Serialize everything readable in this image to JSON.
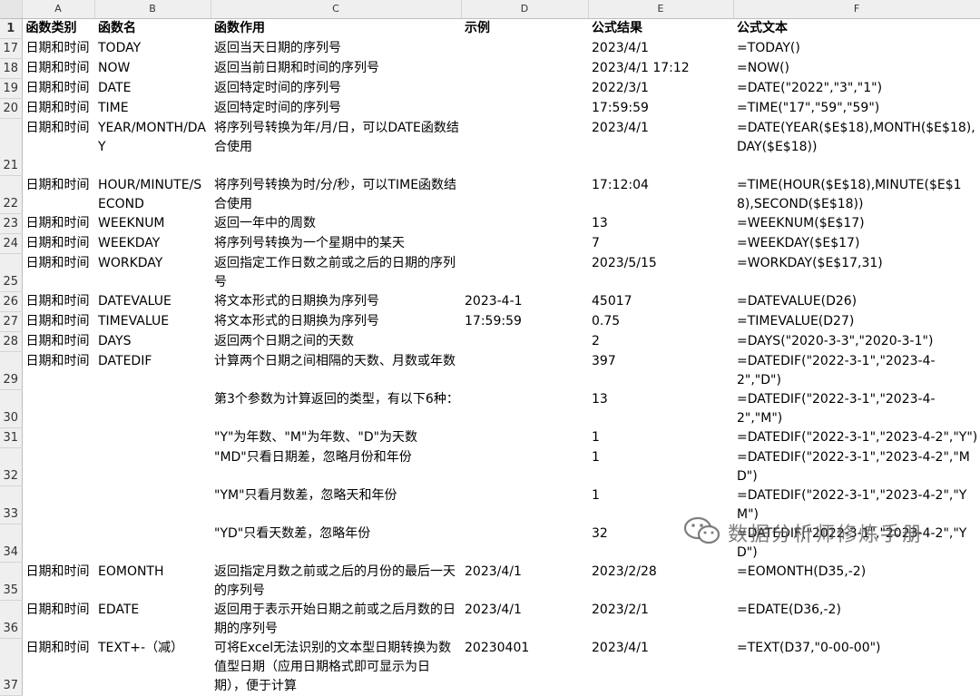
{
  "columns": [
    "A",
    "B",
    "C",
    "D",
    "E",
    "F"
  ],
  "header_row_number": "1",
  "headers": [
    "函数类别",
    "函数名",
    "函数作用",
    "示例",
    "公式结果",
    "公式文本"
  ],
  "rows": [
    {
      "n": "17",
      "h": 21,
      "cells": [
        "日期和时间",
        "TODAY",
        "返回当天日期的序列号",
        "",
        "2023/4/1",
        "=TODAY()"
      ]
    },
    {
      "n": "18",
      "h": 21,
      "cells": [
        "日期和时间",
        "NOW",
        "返回当前日期和时间的序列号",
        "",
        "2023/4/1 17:12",
        "=NOW()"
      ]
    },
    {
      "n": "19",
      "h": 21,
      "cells": [
        "日期和时间",
        "DATE",
        "返回特定时间的序列号",
        "",
        "2022/3/1",
        "=DATE(\"2022\",\"3\",\"1\")"
      ]
    },
    {
      "n": "20",
      "h": 21,
      "cells": [
        "日期和时间",
        "TIME",
        "返回特定时间的序列号",
        "",
        "17:59:59",
        "=TIME(\"17\",\"59\",\"59\")"
      ]
    },
    {
      "n": "21",
      "h": 63,
      "cells": [
        "日期和时间",
        "YEAR/MONTH/DAY",
        "将序列号转换为年/月/日，可以DATE函数结合使用",
        "",
        "2023/4/1",
        "=DATE(YEAR($E$18),MONTH($E$18),DAY($E$18))"
      ]
    },
    {
      "n": "22",
      "h": 42,
      "cells": [
        "日期和时间",
        "HOUR/MINUTE/SECOND",
        "将序列号转换为时/分/秒，可以TIME函数结合使用",
        "",
        "17:12:04",
        "=TIME(HOUR($E$18),MINUTE($E$18),SECOND($E$18))"
      ]
    },
    {
      "n": "23",
      "h": 21,
      "cells": [
        "日期和时间",
        "WEEKNUM",
        "返回一年中的周数",
        "",
        "13",
        "=WEEKNUM($E$17)"
      ]
    },
    {
      "n": "24",
      "h": 21,
      "cells": [
        "日期和时间",
        "WEEKDAY",
        "将序列号转换为一个星期中的某天",
        "",
        "7",
        "=WEEKDAY($E$17)"
      ]
    },
    {
      "n": "25",
      "h": 21,
      "cells": [
        "日期和时间",
        "WORKDAY",
        "返回指定工作日数之前或之后的日期的序列号",
        "",
        "2023/5/15",
        "=WORKDAY($E$17,31)"
      ]
    },
    {
      "n": "26",
      "h": 21,
      "cells": [
        "日期和时间",
        "DATEVALUE",
        "将文本形式的日期换为序列号",
        "2023-4-1",
        "45017",
        "=DATEVALUE(D26)"
      ]
    },
    {
      "n": "27",
      "h": 21,
      "cells": [
        "日期和时间",
        "TIMEVALUE",
        "将文本形式的日期换为序列号",
        "17:59:59",
        "0.75",
        "=TIMEVALUE(D27)"
      ]
    },
    {
      "n": "28",
      "h": 21,
      "cells": [
        "日期和时间",
        "DAYS",
        "返回两个日期之间的天数",
        "",
        "2",
        "=DAYS(\"2020-3-3\",\"2020-3-1\")"
      ]
    },
    {
      "n": "29",
      "h": 21,
      "cells": [
        "日期和时间",
        "DATEDIF",
        "计算两个日期之间相隔的天数、月数或年数",
        "",
        "397",
        "=DATEDIF(\"2022-3-1\",\"2023-4-2\",\"D\")"
      ]
    },
    {
      "n": "30",
      "h": 21,
      "cells": [
        "",
        "",
        "第3个参数为计算返回的类型，有以下6种：",
        "",
        "13",
        "=DATEDIF(\"2022-3-1\",\"2023-4-2\",\"M\")"
      ]
    },
    {
      "n": "31",
      "h": 21,
      "cells": [
        "",
        "",
        "\"Y\"为年数、\"M\"为年数、\"D\"为天数",
        "",
        "1",
        "=DATEDIF(\"2022-3-1\",\"2023-4-2\",\"Y\")"
      ]
    },
    {
      "n": "32",
      "h": 21,
      "cells": [
        "",
        "",
        "\"MD\"只看日期差，忽略月份和年份",
        "",
        "1",
        "=DATEDIF(\"2022-3-1\",\"2023-4-2\",\"MD\")"
      ]
    },
    {
      "n": "33",
      "h": 21,
      "cells": [
        "",
        "",
        "\"YM\"只看月数差，忽略天和年份",
        "",
        "1",
        "=DATEDIF(\"2022-3-1\",\"2023-4-2\",\"YM\")"
      ]
    },
    {
      "n": "34",
      "h": 21,
      "cells": [
        "",
        "",
        "\"YD\"只看天数差，忽略年份",
        "",
        "32",
        "=DATEDIF(\"2022-3-1\",\"2023-4-2\",\"YD\")"
      ]
    },
    {
      "n": "35",
      "h": 42,
      "cells": [
        "日期和时间",
        "EOMONTH",
        "返回指定月数之前或之后的月份的最后一天的序列号",
        "2023/4/1",
        "2023/2/28",
        "=EOMONTH(D35,-2)"
      ]
    },
    {
      "n": "36",
      "h": 42,
      "cells": [
        "日期和时间",
        "EDATE",
        "返回用于表示开始日期之前或之后月数的日期的序列号",
        "2023/4/1",
        "2023/2/1",
        "=EDATE(D36,-2)"
      ]
    },
    {
      "n": "37",
      "h": 63,
      "cells": [
        "日期和时间",
        "TEXT+-（减）",
        "可将Excel无法识别的文本型日期转换为数值型日期（应用日期格式即可显示为日期），便于计算",
        "20230401",
        "2023/4/1",
        "=TEXT(D37,\"0-00-00\")"
      ]
    }
  ],
  "watermark": {
    "icon": "wechat-icon",
    "text": "数据分析师修炼手册"
  }
}
